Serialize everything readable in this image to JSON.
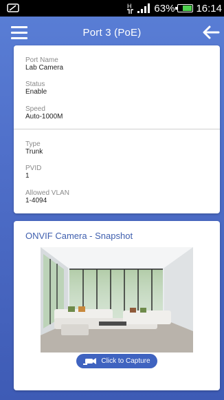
{
  "status_bar": {
    "signal_label": "H",
    "battery_percent": "63%",
    "battery_level": 0.63,
    "time": "16:14"
  },
  "app_bar": {
    "title": "Port 3 (PoE)"
  },
  "port_info": {
    "port_name": {
      "label": "Port Name",
      "value": "Lab Camera"
    },
    "status": {
      "label": "Status",
      "value": "Enable"
    },
    "speed": {
      "label": "Speed",
      "value": "Auto-1000M"
    },
    "type": {
      "label": "Type",
      "value": "Trunk"
    },
    "pvid": {
      "label": "PVID",
      "value": "1"
    },
    "allowed_vlan": {
      "label": "Allowed VLAN",
      "value": "1-4094"
    }
  },
  "snapshot": {
    "title": "ONVIF Camera - Snapshot",
    "capture_label": "Click to Capture"
  },
  "colors": {
    "accent": "#3f63c0",
    "title_blue": "#3f5fae",
    "battery_green": "#4fd14f"
  },
  "icons": [
    "notification-icon",
    "signal-icon",
    "battery-icon",
    "menu-icon",
    "back-arrow-icon",
    "camera-icon"
  ]
}
